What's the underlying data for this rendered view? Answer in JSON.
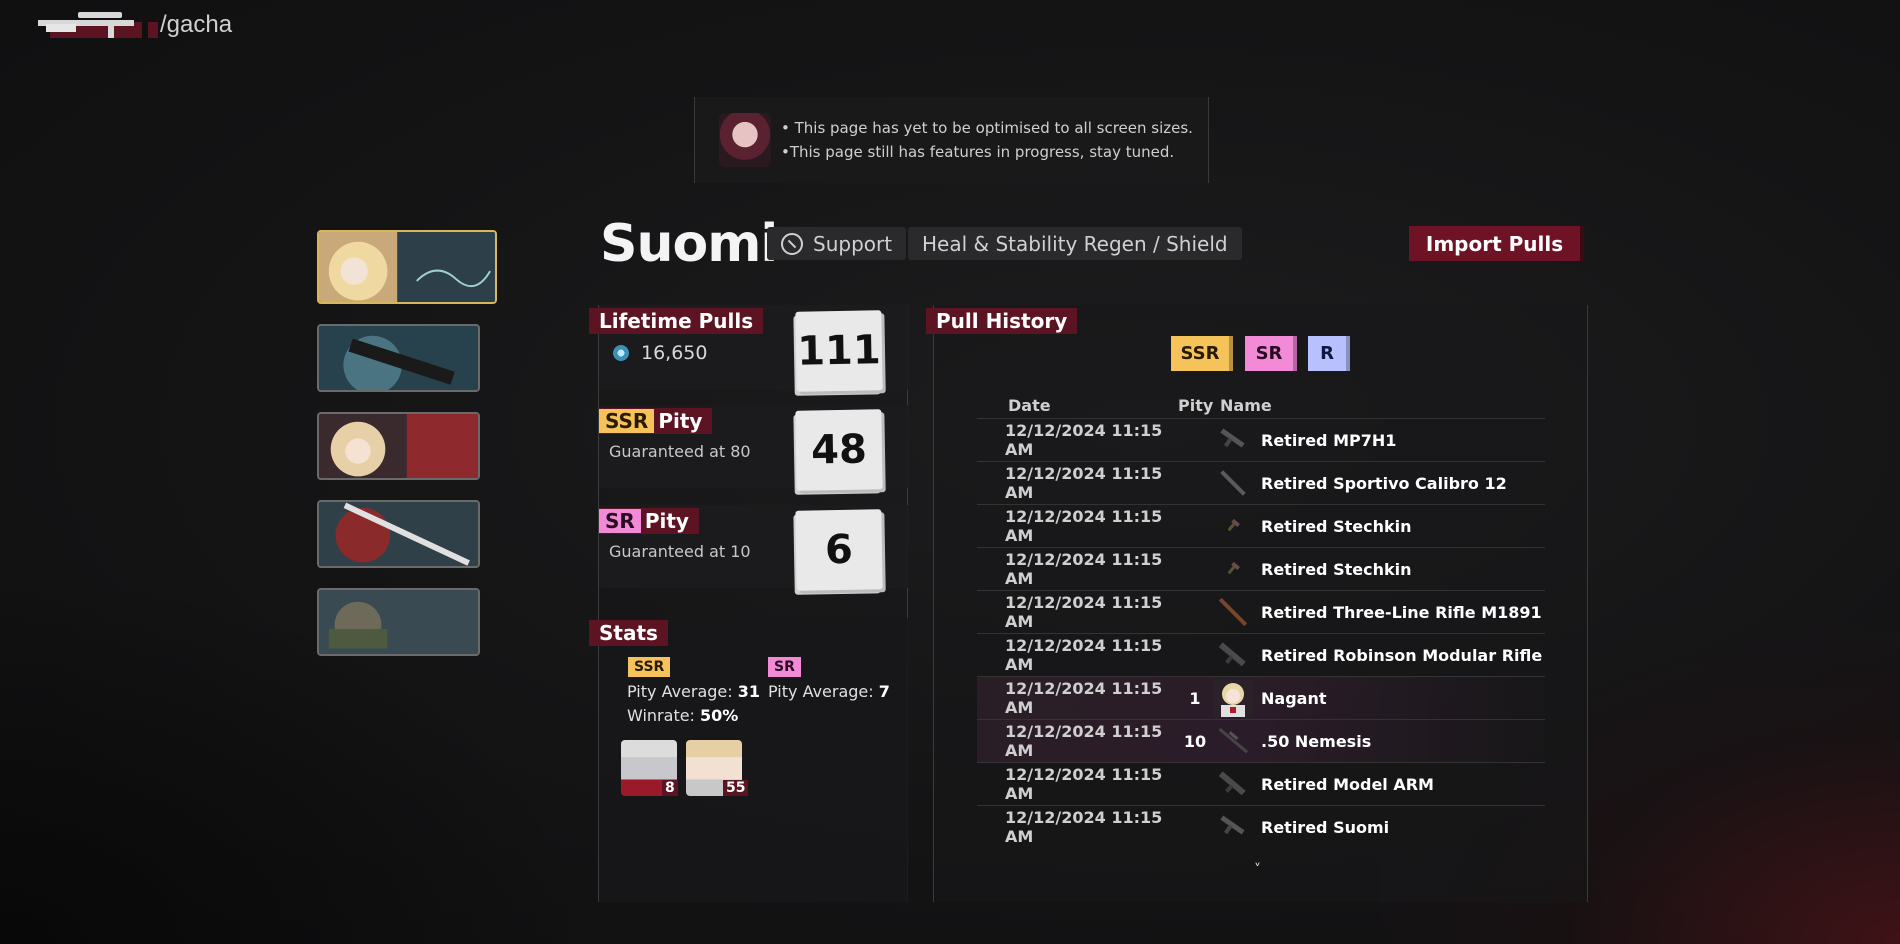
{
  "nav": {
    "path": "/gacha"
  },
  "notice": {
    "lines": [
      "• This page has yet to be optimised to all screen sizes.",
      "•This page still has features in progress, stay tuned."
    ]
  },
  "character": {
    "name": "Suomi",
    "role": "Support",
    "skill": "Heal & Stability Regen / Shield"
  },
  "import_button": "Import Pulls",
  "lifetime": {
    "label": "Lifetime Pulls",
    "currency": "16,650",
    "count": "111"
  },
  "ssr_pity": {
    "chip": "SSR",
    "label": "Pity",
    "sub": "Guaranteed at 80",
    "count": "48"
  },
  "sr_pity": {
    "chip": "SR",
    "label": "Pity",
    "sub": "Guaranteed at 10",
    "count": "6"
  },
  "stats": {
    "label": "Stats",
    "ssr": {
      "chip": "SSR",
      "pity_label": "Pity Average: ",
      "pity_value": "31",
      "win_label": "Winrate: ",
      "win_value": "50%"
    },
    "sr": {
      "chip": "SR",
      "pity_label": "Pity Average: ",
      "pity_value": "7"
    },
    "pulled": [
      {
        "count": "8"
      },
      {
        "count": "55"
      }
    ]
  },
  "history": {
    "label": "Pull History",
    "filters": [
      "SSR",
      "SR",
      "R"
    ],
    "headers": {
      "date": "Date",
      "pity": "Pity",
      "name": "Name"
    },
    "rows": [
      {
        "date": "12/12/2024 11:15 AM",
        "pity": "",
        "name": "Retired MP7H1",
        "icon": "smg-icon"
      },
      {
        "date": "12/12/2024 11:15 AM",
        "pity": "",
        "name": "Retired Sportivo Calibro 12",
        "icon": "shotgun-icon"
      },
      {
        "date": "12/12/2024 11:15 AM",
        "pity": "",
        "name": "Retired Stechkin",
        "icon": "pistol-icon"
      },
      {
        "date": "12/12/2024 11:15 AM",
        "pity": "",
        "name": "Retired Stechkin",
        "icon": "pistol-icon"
      },
      {
        "date": "12/12/2024 11:15 AM",
        "pity": "",
        "name": "Retired Three-Line Rifle M1891",
        "icon": "rifle-icon"
      },
      {
        "date": "12/12/2024 11:15 AM",
        "pity": "",
        "name": "Retired Robinson Modular Rifle",
        "icon": "assault-rifle-icon"
      },
      {
        "date": "12/12/2024 11:15 AM",
        "pity": "1",
        "name": "Nagant",
        "icon": "character-portrait-icon"
      },
      {
        "date": "12/12/2024 11:15 AM",
        "pity": "10",
        "name": ".50 Nemesis",
        "icon": "sniper-icon"
      },
      {
        "date": "12/12/2024 11:15 AM",
        "pity": "",
        "name": "Retired Model ARM",
        "icon": "assault-rifle-icon"
      },
      {
        "date": "12/12/2024 11:15 AM",
        "pity": "",
        "name": "Retired Suomi",
        "icon": "smg-icon"
      }
    ],
    "more": "˅"
  },
  "colors": {
    "accent": "#5c1423",
    "ssr": "#f5c35a",
    "sr": "#f28ad8",
    "r": "#b8c0ff"
  }
}
